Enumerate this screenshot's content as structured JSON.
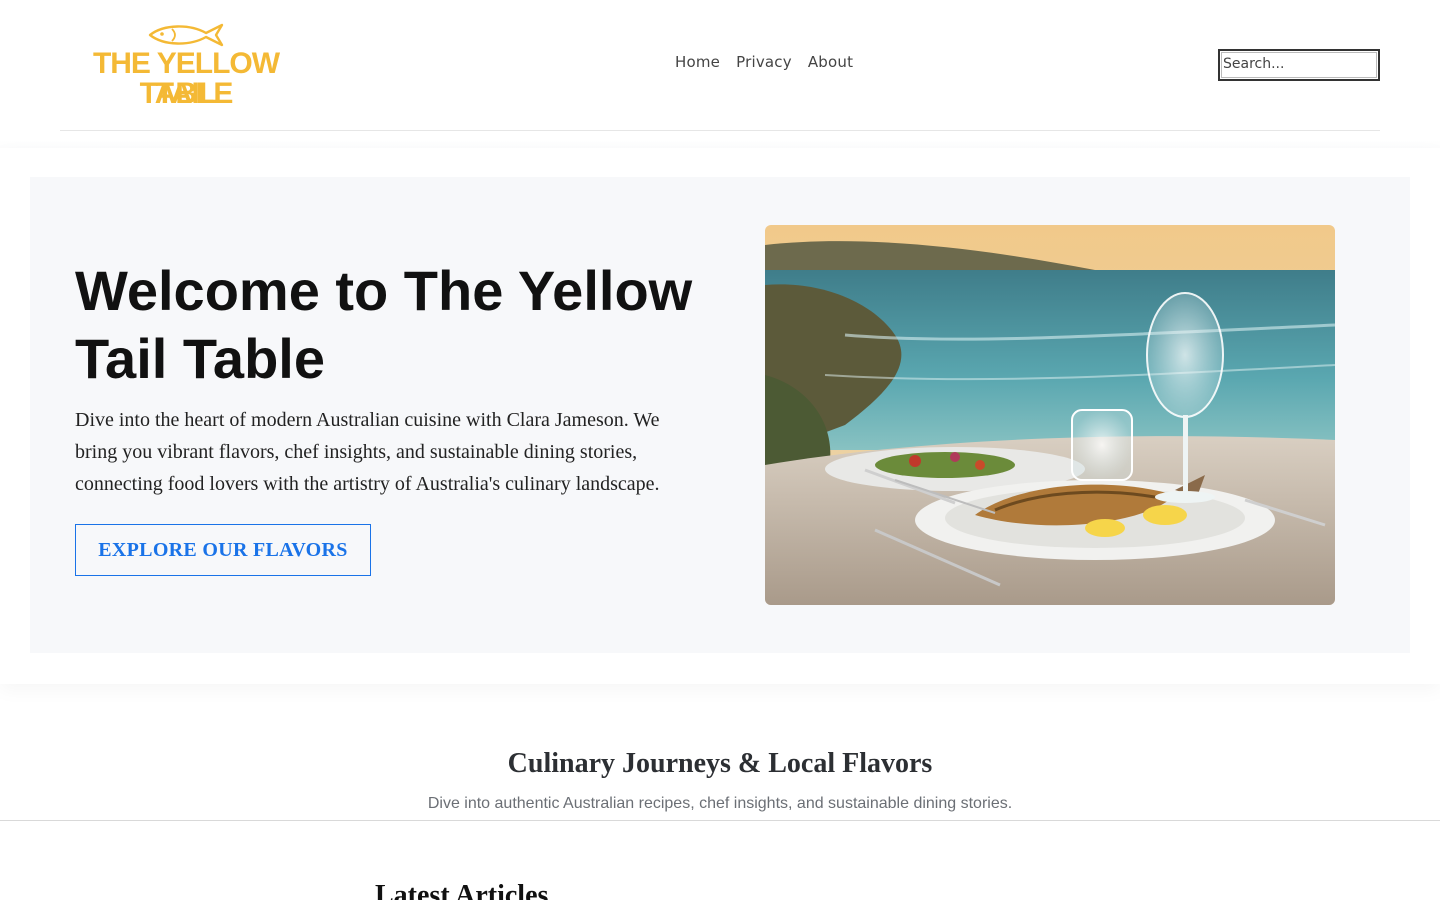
{
  "header": {
    "logo": {
      "line1": "THE YELLOW TAIL",
      "line2": "TABLE",
      "icon": "fish-icon",
      "color": "#f4b935"
    },
    "nav": [
      {
        "label": "Home"
      },
      {
        "label": "Privacy"
      },
      {
        "label": "About"
      }
    ],
    "search": {
      "placeholder": "Search..."
    }
  },
  "hero": {
    "title": "Welcome to The Yellow Tail Table",
    "description": "Dive into the heart of modern Australian cuisine with Clara Jameson. We bring you vibrant flavors, chef insights, and sustainable dining stories, connecting food lovers with the artistry of Australia's culinary landscape.",
    "cta_label": "EXPLORE OUR FLAVORS",
    "image": "coastal-seafood-dinner-photo",
    "accent": "#1a73e8"
  },
  "section": {
    "title": "Culinary Journeys & Local Flavors",
    "subtitle": "Dive into authentic Australian recipes, chef insights, and sustainable dining stories."
  },
  "latest": {
    "title": "Latest Articles"
  }
}
